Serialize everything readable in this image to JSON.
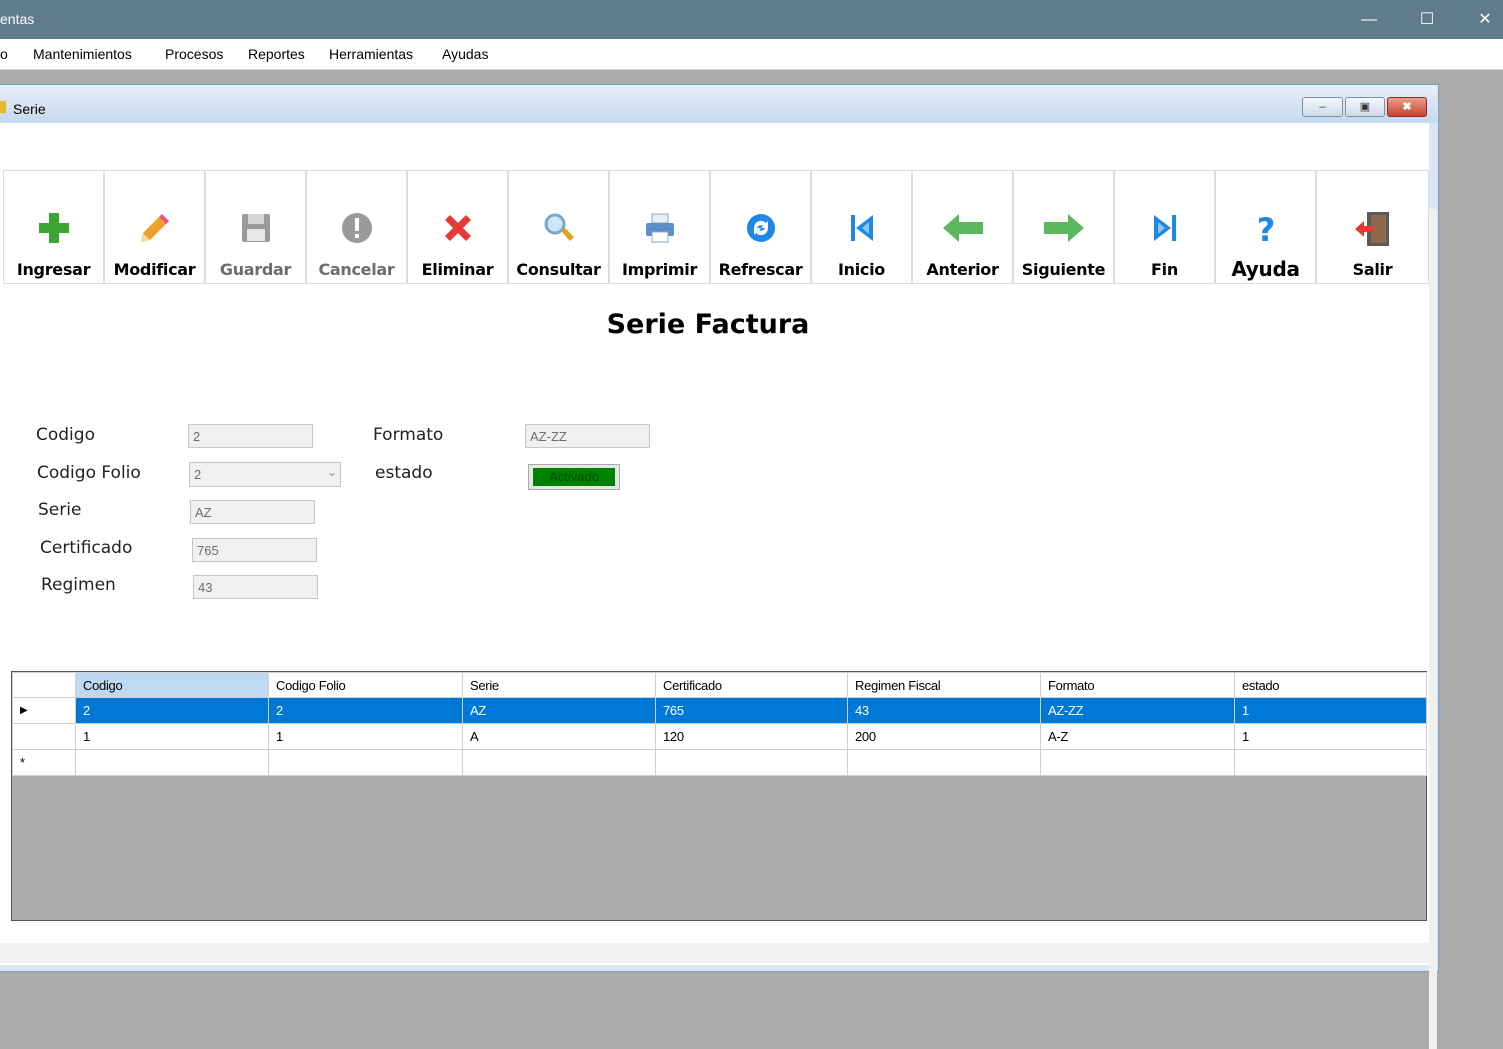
{
  "window": {
    "title": "entas",
    "minimize": "—",
    "maximize": "☐",
    "close": "✕"
  },
  "menu": {
    "items": [
      "o",
      "Mantenimientos",
      "Procesos",
      "Reportes",
      "Herramientas",
      "Ayudas"
    ]
  },
  "child": {
    "title": "Serie",
    "min": "–",
    "restore": "▣",
    "close": "✖"
  },
  "toolbar": {
    "buttons": [
      {
        "label": "Ingresar",
        "icon": "plus-icon",
        "color": "#3da632"
      },
      {
        "label": "Modificar",
        "icon": "pencil-icon",
        "color": "#f0a028"
      },
      {
        "label": "Guardar",
        "icon": "floppy-disk-icon",
        "color": "#9a9a9a"
      },
      {
        "label": "Cancelar",
        "icon": "cancel-circle-icon",
        "color": "#9a9a9a"
      },
      {
        "label": "Eliminar",
        "icon": "red-x-icon",
        "color": "#e53935"
      },
      {
        "label": "Consultar",
        "icon": "magnifier-icon",
        "color": "#e0a020"
      },
      {
        "label": "Imprimir",
        "icon": "printer-icon",
        "color": "#5a8fc8"
      },
      {
        "label": "Refrescar",
        "icon": "refresh-icon",
        "color": "#1e88e5"
      },
      {
        "label": "Inicio",
        "icon": "first-record-icon",
        "color": "#1e88e5"
      },
      {
        "label": "Anterior",
        "icon": "left-arrow-icon",
        "color": "#5cb85c"
      },
      {
        "label": "Siguiente",
        "icon": "right-arrow-icon",
        "color": "#5cb85c"
      },
      {
        "label": "Fin",
        "icon": "last-record-icon",
        "color": "#1e88e5"
      },
      {
        "label": "Ayuda",
        "icon": "question-mark-icon",
        "color": "#1e88e5"
      },
      {
        "label": "Salir",
        "icon": "exit-door-icon",
        "color": "#e53935"
      }
    ]
  },
  "form": {
    "title": "Serie Factura",
    "codigo_label": "Codigo",
    "codigo_value": "2",
    "codigo_folio_label": "Codigo Folio",
    "codigo_folio_value": "2",
    "serie_label": "Serie",
    "serie_value": "AZ",
    "certificado_label": "Certificado",
    "certificado_value": "765",
    "regimen_label": "Regimen",
    "regimen_value": "43",
    "formato_label": "Formato",
    "formato_value": "AZ-ZZ",
    "estado_label": "estado",
    "estado_value": "Activado",
    "estado_color": "#008000"
  },
  "grid": {
    "columns": [
      "Codigo",
      "Codigo Folio",
      "Serie",
      "Certificado",
      "Regimen Fiscal",
      "Formato",
      "estado"
    ],
    "rows": [
      {
        "marker": "▶",
        "cells": [
          "2",
          "2",
          "AZ",
          "765",
          "43",
          "AZ-ZZ",
          "1"
        ]
      },
      {
        "marker": "",
        "cells": [
          "1",
          "1",
          "A",
          "120",
          "200",
          "A-Z",
          "1"
        ]
      }
    ],
    "new_row_marker": "*",
    "selection_color": "#0078d7"
  }
}
